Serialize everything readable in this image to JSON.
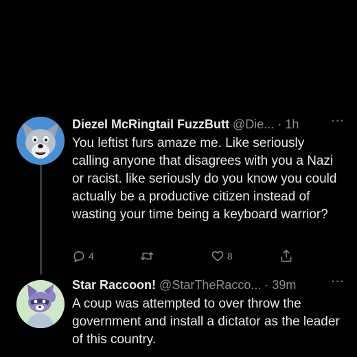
{
  "tweets": [
    {
      "name": "Diezel McRingtail FuzzButt",
      "handle": "@Die...",
      "separator": "·",
      "time": "1h",
      "more": "···",
      "text": "You leftist furs amaze me. Like seriously calling anyone that disagrees with you a Nazi or racist. like seriously do you know you could actually be a productive citizen instead of wasting your time being a keyboard warrior?",
      "avatar_icon": "wolf-avatar-icon",
      "reply_count": "4",
      "retweet_count": "",
      "like_count": "8"
    },
    {
      "name": "Star Raccoon!",
      "handle": "@StarTheRacco...",
      "separator": "·",
      "time": "39m",
      "more": "···",
      "text": "A coup was attempted to over throw the government and install a dictator as the leader of this country.",
      "avatar_icon": "raccoon-avatar-icon"
    }
  ],
  "colors": {
    "background": "#000000",
    "text": "#e7e9ea",
    "secondary": "#8b8f94",
    "thread_line": "#38393b"
  }
}
